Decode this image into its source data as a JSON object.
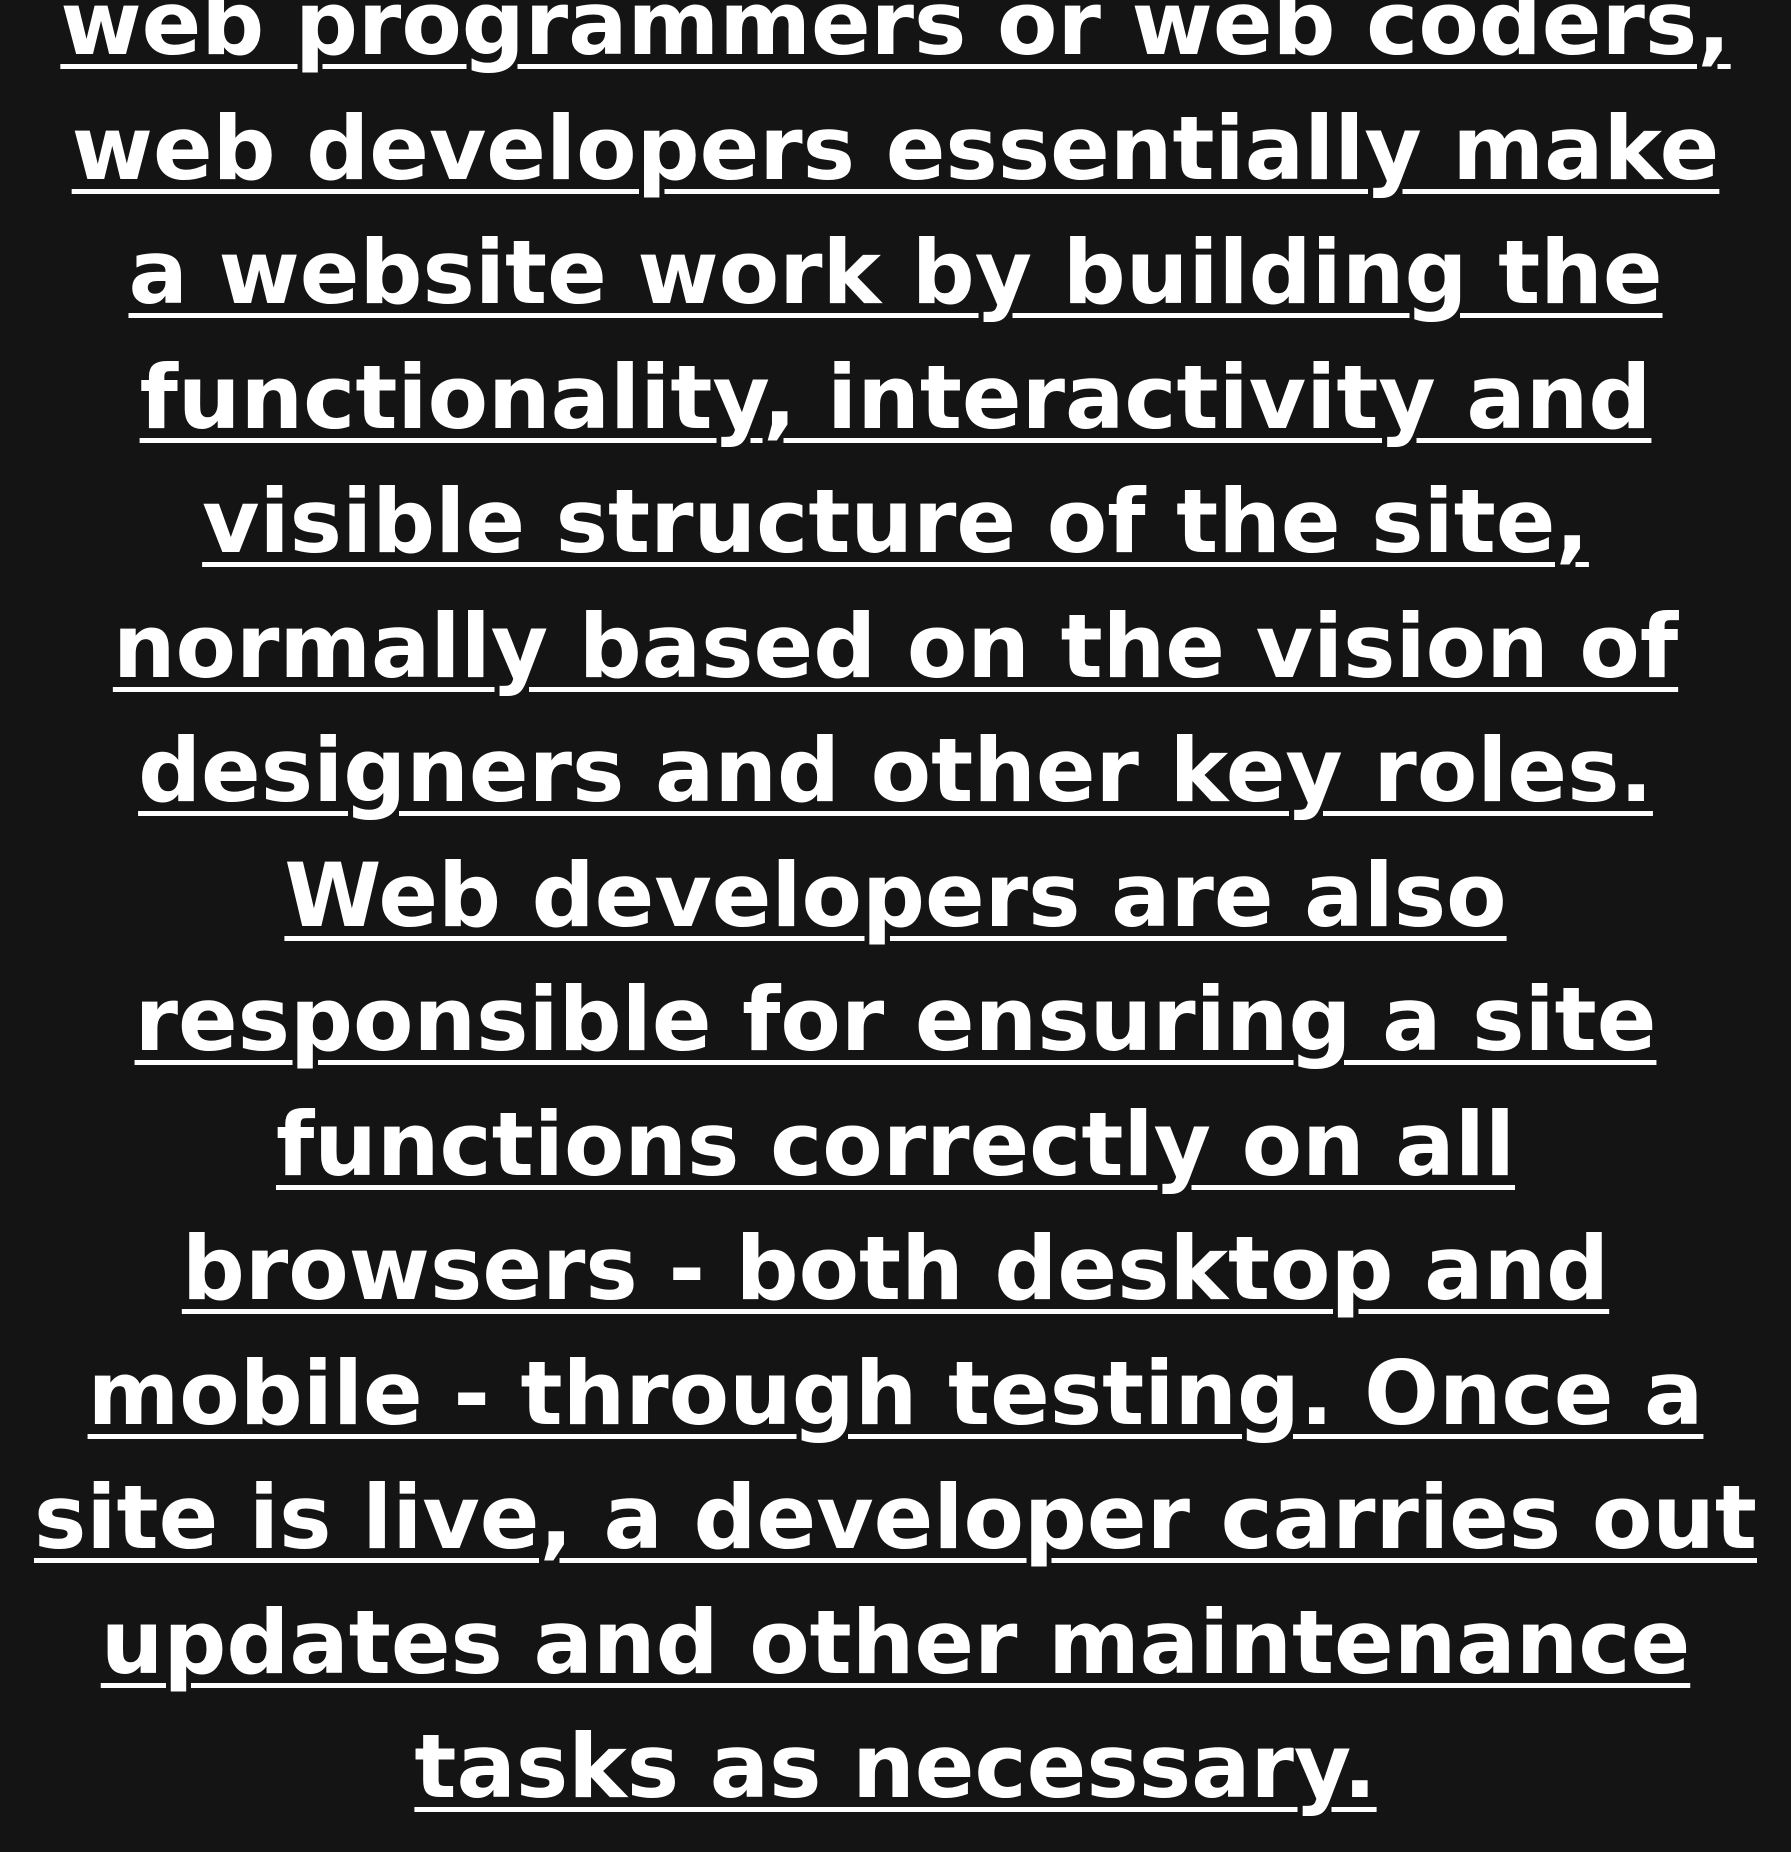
{
  "article": {
    "lines": [
      "web programmers or web coders,",
      "web developers essentially make",
      "a website work by building the",
      "functionality, interactivity and",
      "visible structure of the site,",
      "normally based on the vision of",
      "designers and other key roles.",
      "Web developers are also",
      "responsible for ensuring a site",
      "functions correctly on all",
      "browsers - both desktop and",
      "mobile - through testing. Once a",
      "site is live, a developer carries out",
      "updates and other maintenance",
      "tasks as necessary."
    ]
  },
  "colors": {
    "background": "#141414",
    "text": "#ffffff"
  }
}
